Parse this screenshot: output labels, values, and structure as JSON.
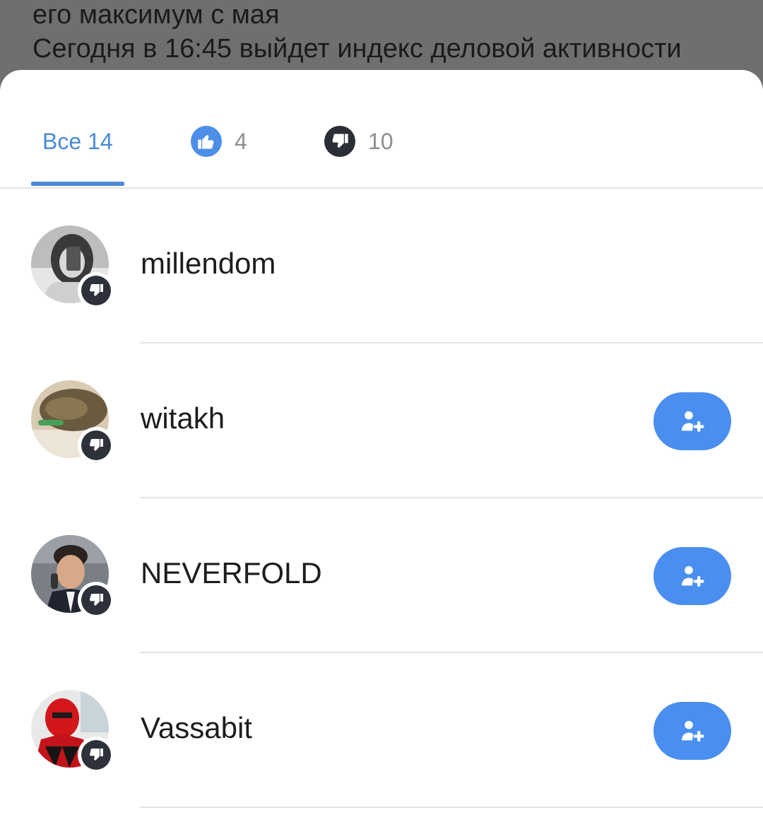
{
  "background_post": {
    "line1": "его максимум с мая",
    "line2": "Сегодня в 16:45 выйдет индекс деловой активности"
  },
  "tabs": {
    "all": {
      "label": "Все 14"
    },
    "likes": {
      "count": "4",
      "icon": "thumbs-up-icon"
    },
    "dislikes": {
      "count": "10",
      "icon": "thumbs-down-icon"
    }
  },
  "users": [
    {
      "name": "millendom",
      "reaction": "thumbs-down-icon",
      "show_add": false
    },
    {
      "name": "witakh",
      "reaction": "thumbs-down-icon",
      "show_add": true
    },
    {
      "name": "NEVERFOLD",
      "reaction": "thumbs-down-icon",
      "show_add": true
    },
    {
      "name": "Vassabit",
      "reaction": "thumbs-down-icon",
      "show_add": true
    }
  ],
  "colors": {
    "accent": "#4a8ad6",
    "add_button": "#4a8ff0",
    "like_icon": "#4d8fe8",
    "dislike_icon": "#2a2f36"
  },
  "icons": {
    "add_friend": "add-friend-icon"
  }
}
